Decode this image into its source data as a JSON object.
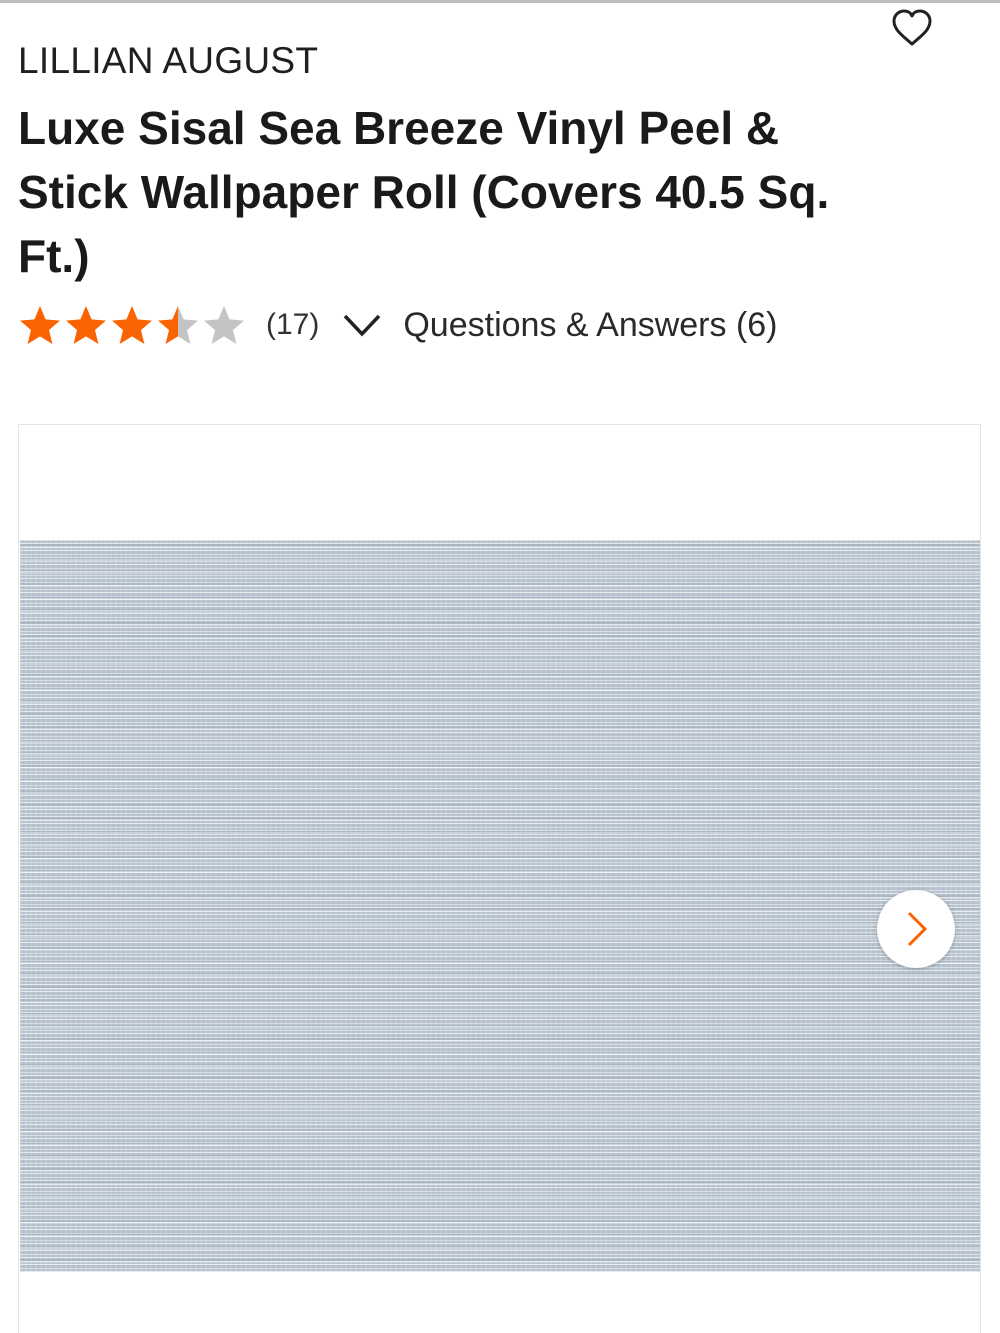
{
  "product": {
    "brand": "LILLIAN AUGUST",
    "title": "Luxe Sisal Sea Breeze Vinyl Peel & Stick Wallpaper Roll (Covers 40.5 Sq. Ft.)",
    "rating": {
      "value": 3.5,
      "max": 5,
      "count_label": "(17)"
    },
    "qa_label": "Questions & Answers (6)"
  },
  "gallery": {
    "image_name": "wallpaper-product-image",
    "next_icon": "chevron-right-icon"
  },
  "icons": {
    "favorite": "heart-outline-icon",
    "star": "star-icon",
    "expand": "chevron-down-icon"
  },
  "colors": {
    "star_filled": "#f96302",
    "star_empty": "#c4c4c4",
    "text": "#1a1a1a",
    "next_arrow": "#f96302"
  }
}
